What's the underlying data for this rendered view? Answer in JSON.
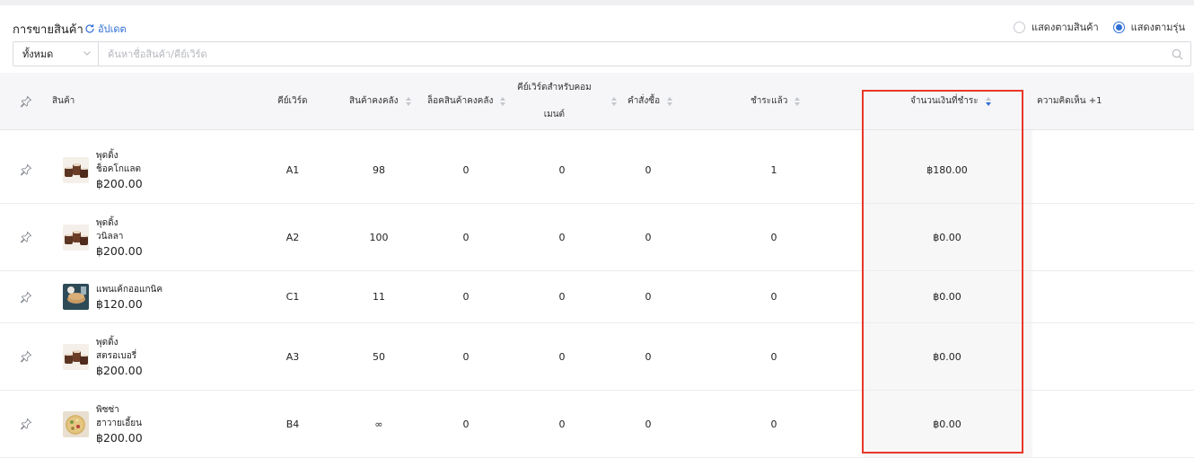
{
  "header": {
    "title": "การขายสินค้า",
    "update_label": "อัปเดต",
    "view_options": [
      {
        "label": "แสดงตามสินค้า",
        "selected": false
      },
      {
        "label": "แสดงตามรุ่น",
        "selected": true
      }
    ]
  },
  "filter": {
    "category_value": "ทั้งหมด",
    "search_placeholder": "ค้นหาชื่อสินค้า/คีย์เวิร์ด"
  },
  "table": {
    "columns": {
      "product": "สินค้า",
      "keyword": "คีย์เวิร์ด",
      "stock": "สินค้าคงคลัง",
      "locked_stock": "ล็อคสินค้าคงคลัง",
      "comment_keyword_line1": "คีย์เวิร์ดสำหรับคอม",
      "comment_keyword_line2": "เมนต์",
      "orders": "คำสั่งซื้อ",
      "paid": "ชำระแล้ว",
      "amount_paid": "จำนวนเงินที่ชำระ",
      "comments": "ความคิดเห็น +1"
    },
    "rows": [
      {
        "name_line1": "พุดดิ้ง",
        "name_line2": "ช็อคโกแลต",
        "price": "฿200.00",
        "keyword": "A1",
        "stock": "98",
        "locked_stock": "0",
        "comment_keyword": "0",
        "orders": "0",
        "paid": "1",
        "amount_paid": "฿180.00",
        "thumb": "pudding"
      },
      {
        "name_line1": "พุดดิ้ง",
        "name_line2": "วนิลลา",
        "price": "฿200.00",
        "keyword": "A2",
        "stock": "100",
        "locked_stock": "0",
        "comment_keyword": "0",
        "orders": "0",
        "paid": "0",
        "amount_paid": "฿0.00",
        "thumb": "pudding"
      },
      {
        "name_line1": "แพนเค้กออแกนิค",
        "name_line2": "",
        "price": "฿120.00",
        "keyword": "C1",
        "stock": "11",
        "locked_stock": "0",
        "comment_keyword": "0",
        "orders": "0",
        "paid": "0",
        "amount_paid": "฿0.00",
        "thumb": "pancake"
      },
      {
        "name_line1": "พุดดิ้ง",
        "name_line2": "สตรอเบอรี่",
        "price": "฿200.00",
        "keyword": "A3",
        "stock": "50",
        "locked_stock": "0",
        "comment_keyword": "0",
        "orders": "0",
        "paid": "0",
        "amount_paid": "฿0.00",
        "thumb": "pudding"
      },
      {
        "name_line1": "พิซซ่า",
        "name_line2": "ฮาวายเอี้ยน",
        "price": "฿200.00",
        "keyword": "B4",
        "stock": "∞",
        "locked_stock": "0",
        "comment_keyword": "0",
        "orders": "0",
        "paid": "0",
        "amount_paid": "฿0.00",
        "thumb": "pizza"
      }
    ]
  },
  "colors": {
    "accent": "#2f6fd6",
    "highlight_border": "#e8372a"
  },
  "icons": {
    "refresh": "refresh-icon",
    "pin": "pin-icon",
    "search": "search-icon",
    "chevron": "chevron-down-icon"
  }
}
